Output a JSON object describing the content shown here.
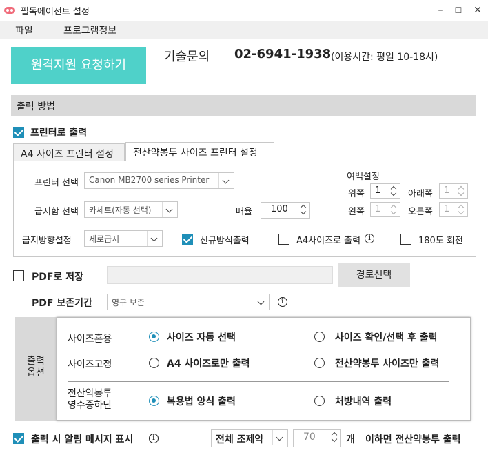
{
  "window": {
    "title": "필독에이전트 설정",
    "minimize": "–",
    "maximize": "☐",
    "close": "✕"
  },
  "menu": {
    "file": "파일",
    "program_info": "프로그램정보"
  },
  "remote": {
    "button": "원격지원 요청하기",
    "support_label": "기술문의",
    "phone": "02-6941-1938",
    "hours": "(이용시간: 평일 10-18시)"
  },
  "output_method": {
    "header": "출력 방법",
    "printer_output": "프린터로 출력",
    "tabs": [
      "A4 사이즈 프린터 설정",
      "전산약봉투 사이즈 프린터 설정"
    ],
    "printer_select_label": "프린터 선택",
    "printer_select_value": "Canon MB2700 series Printer",
    "tray_label": "급지함 선택",
    "tray_value": "카세트(자동 선택)",
    "scale_label": "배율",
    "scale_value": "100",
    "margin_title": "여백설정",
    "margin_top_label": "위쪽",
    "margin_top_value": "1",
    "margin_bottom_label": "아래쪽",
    "margin_bottom_value": "1",
    "margin_left_label": "왼쪽",
    "margin_left_value": "1",
    "margin_right_label": "오른쪽",
    "margin_right_value": "1",
    "feed_dir_label": "급지방향설정",
    "feed_dir_value": "세로급지",
    "new_method": "신규방식출력",
    "a4_output": "A4사이즈로 출력",
    "rotate180": "180도 회전"
  },
  "pdf": {
    "save_label": "PDF로 저장",
    "path_value": "",
    "path_button": "경로선택",
    "period_label": "PDF 보존기간",
    "period_value": "영구 보존"
  },
  "print_options": {
    "side_label": "출력\n옵션",
    "size_mixed_label": "사이즈혼용",
    "size_fixed_label": "사이즈고정",
    "receipt_label": "전산약봉투\n영수증하단",
    "auto_size": "사이즈 자동 선택",
    "confirm_size": "사이즈 확인/선택 후 출력",
    "a4_only": "A4 사이즈로만 출력",
    "envelope_only": "전산약봉투 사이즈만 출력",
    "medication_form": "복용법 양식 출력",
    "prescription": "처방내역 출력"
  },
  "footer": {
    "alert_label": "출력 시 알림 메시지 표시",
    "combo_value": "전체 조제약",
    "count_value": "70",
    "unit": "개",
    "suffix": "이하면 전산약봉투 출력"
  }
}
